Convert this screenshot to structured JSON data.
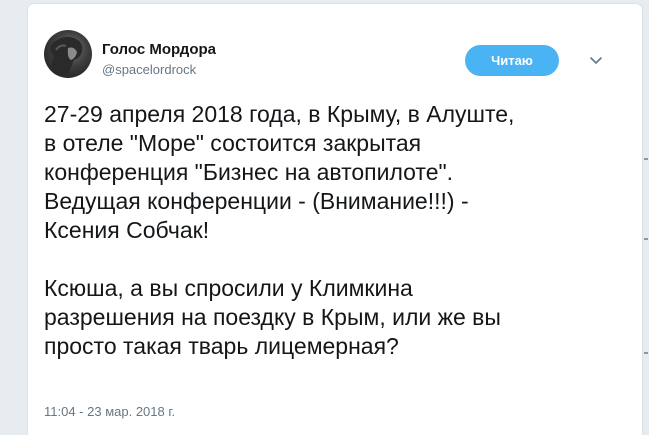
{
  "tweet": {
    "author_name": "Голос Мордора",
    "author_handle": "@spacelordrock",
    "follow_label": "Читаю",
    "text": "27-29 апреля 2018 года, в Крыму, в Алуште,\nв отеле \"Море\" состоится закрытая\nконференция \"Бизнес на автопилоте\".\nВедущая конференции - (Внимание!!!) -\nКсения Собчак!\n\nКсюша, а вы спросили у Климкина\nразрешения на поездку в Крым, или же вы\nпросто такая тварь лицемерная?",
    "timestamp": "11:04 - 23 мар. 2018 г."
  },
  "colors": {
    "accent": "#4ab3f4",
    "text": "#14171a",
    "secondary": "#657786",
    "background": "#e6ecf0"
  },
  "icons": {
    "menu": "chevron-down-icon",
    "avatar": "avatar"
  }
}
